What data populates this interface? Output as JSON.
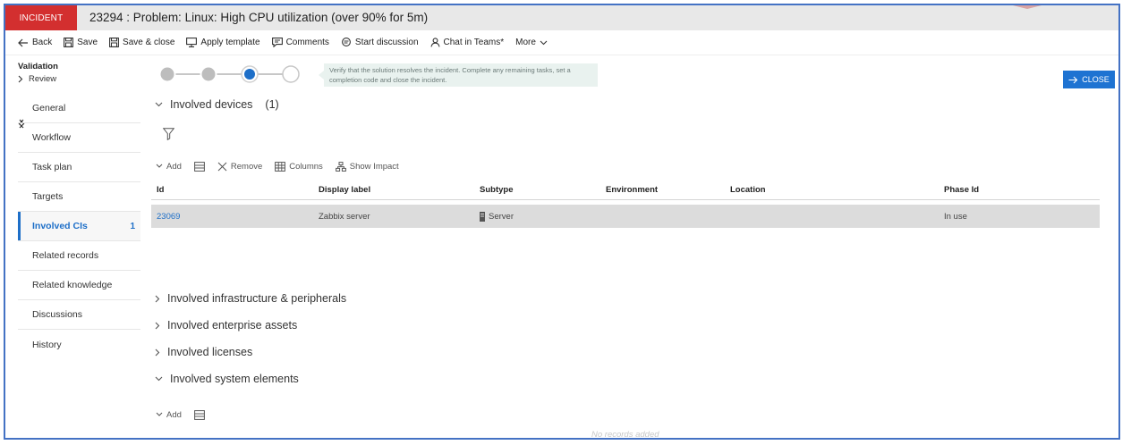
{
  "header": {
    "badge": "INCIDENT",
    "title": "23294 : Problem: Linux: High CPU utilization (over 90% for 5m)"
  },
  "toolbar": {
    "back": "Back",
    "save": "Save",
    "save_close": "Save & close",
    "apply_template": "Apply template",
    "comments": "Comments",
    "start_discussion": "Start discussion",
    "chat_teams": "Chat in Teams*",
    "more": "More"
  },
  "breadcrumb": {
    "phase": "Validation",
    "step": "Review"
  },
  "nav": {
    "items": [
      {
        "label": "General"
      },
      {
        "label": "Workflow"
      },
      {
        "label": "Task plan"
      },
      {
        "label": "Targets"
      },
      {
        "label": "Involved CIs",
        "count": "1"
      },
      {
        "label": "Related records"
      },
      {
        "label": "Related knowledge"
      },
      {
        "label": "Discussions"
      },
      {
        "label": "History"
      }
    ]
  },
  "stepper": {
    "tooltip": "Verify that the solution resolves the incident. Complete any remaining tasks, set a completion code and close the incident."
  },
  "close_button": "CLOSE",
  "devices": {
    "title": "Involved devices",
    "count": "(1)",
    "tools": {
      "add": "Add",
      "remove": "Remove",
      "columns": "Columns",
      "show_impact": "Show Impact"
    },
    "columns": [
      "Id",
      "Display label",
      "Subtype",
      "Environment",
      "Location",
      "Phase Id"
    ],
    "rows": [
      {
        "id": "23069",
        "display_label": "Zabbix server",
        "subtype": "Server",
        "environment": "",
        "location": "",
        "phase": "In use"
      }
    ]
  },
  "sections": {
    "infrastructure": "Involved infrastructure & peripherals",
    "enterprise_assets": "Involved enterprise assets",
    "licenses": "Involved licenses",
    "system_elements": "Involved system elements"
  },
  "system_elements": {
    "add": "Add",
    "empty": "No records added"
  },
  "colors": {
    "badge": "#d32f2f",
    "accent": "#1e6fc8",
    "frame": "#4472c4"
  }
}
